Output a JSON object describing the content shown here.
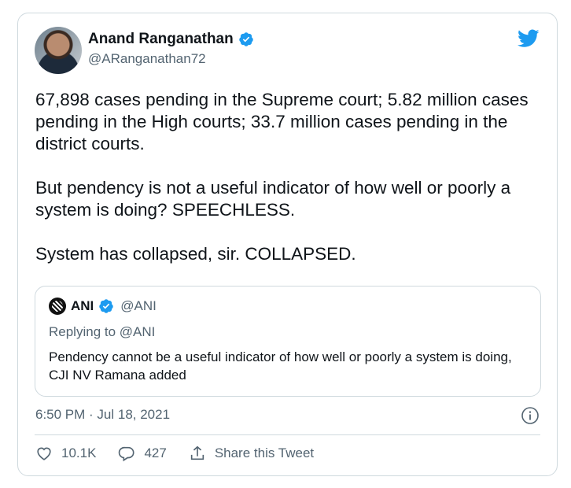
{
  "tweet": {
    "author": {
      "name": "Anand Ranganathan",
      "handle": "@ARanganathan72"
    },
    "paragraphs": [
      "67,898 cases pending in the Supreme court; 5.82 million cases pending in the High courts; 33.7 million cases pending in the district courts.",
      "But pendency is not a useful indicator of how well or poorly a system is doing? SPEECHLESS.",
      "System has collapsed, sir. COLLAPSED."
    ],
    "quoted": {
      "name": "ANI",
      "handle": "@ANI",
      "replying_to": "Replying to @ANI",
      "text": "Pendency cannot be a useful indicator of how well or poorly a system is doing, CJI NV Ramana added"
    },
    "timestamp": "6:50 PM · Jul 18, 2021",
    "actions": {
      "likes": "10.1K",
      "replies": "427",
      "share_label": "Share this Tweet"
    }
  },
  "colors": {
    "verified": "#1d9bf0",
    "twitter_blue": "#1d9bf0",
    "muted": "#536471",
    "border": "#cfd9de"
  },
  "icons": [
    "twitter-bird-icon",
    "verified-badge-icon",
    "info-icon",
    "heart-icon",
    "reply-icon",
    "share-icon"
  ]
}
